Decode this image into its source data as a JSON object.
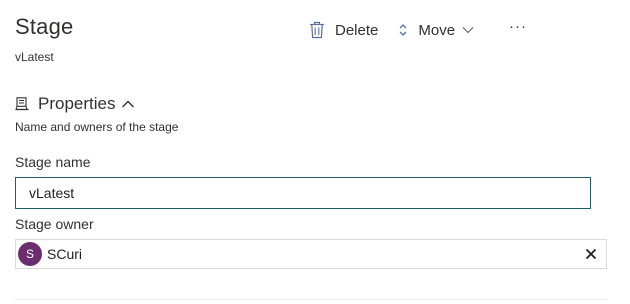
{
  "header": {
    "title": "Stage",
    "subtitle": "vLatest"
  },
  "toolbar": {
    "delete_label": "Delete",
    "move_label": "Move",
    "more_label": "···",
    "delete_icon": "trash-icon",
    "move_icon": "up-down-icon",
    "move_chevron_icon": "chevron-down-icon"
  },
  "properties": {
    "icon": "properties-icon",
    "title": "Properties",
    "collapse_icon": "chevron-up-icon",
    "description": "Name and owners of the stage"
  },
  "form": {
    "stage_name_label": "Stage name",
    "stage_name_value": "vLatest",
    "stage_owner_label": "Stage owner",
    "owner": {
      "initials": "S",
      "name": "SCuri",
      "avatar_color": "#6b2d6e"
    },
    "clear_icon": "close-icon"
  },
  "colors": {
    "input_focus_border": "#1e5e6b",
    "text": "#323130",
    "accent_icon": "#5a6f9a"
  }
}
